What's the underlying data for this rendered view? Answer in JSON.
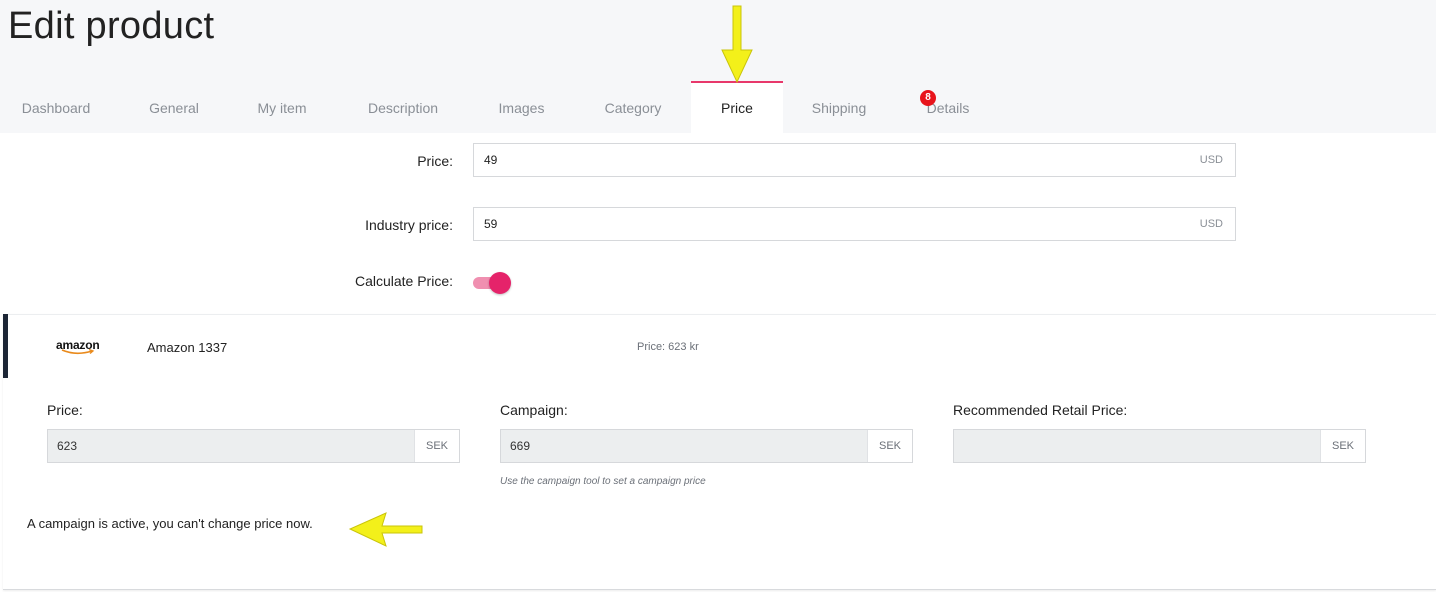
{
  "page": {
    "title": "Edit product"
  },
  "tabs": [
    {
      "label": "Dashboard",
      "active": false
    },
    {
      "label": "General",
      "active": false
    },
    {
      "label": "My item",
      "active": false
    },
    {
      "label": "Description",
      "active": false
    },
    {
      "label": "Images",
      "active": false
    },
    {
      "label": "Category",
      "active": false
    },
    {
      "label": "Price",
      "active": true
    },
    {
      "label": "Shipping",
      "active": false
    },
    {
      "label": "Details",
      "active": false,
      "badge": "8"
    }
  ],
  "price_form": {
    "price_label": "Price:",
    "price_value": "49",
    "price_unit": "USD",
    "industry_label": "Industry price:",
    "industry_value": "59",
    "industry_unit": "USD",
    "calculate_label": "Calculate Price:",
    "calculate_on": true
  },
  "channel": {
    "logo_text": "amazon",
    "name": "Amazon 1337",
    "price_text": "Price: 623 kr",
    "fields": {
      "price_label": "Price:",
      "price_value": "623",
      "price_unit": "SEK",
      "campaign_label": "Campaign:",
      "campaign_value": "669",
      "campaign_unit": "SEK",
      "campaign_hint": "Use the campaign tool to set a campaign price",
      "rrp_label": "Recommended Retail Price:",
      "rrp_value": "",
      "rrp_unit": "SEK"
    },
    "notice": "A campaign is active, you can't change price now."
  },
  "colors": {
    "accent": "#e5236a",
    "toggle_track": "#f08fb0",
    "badge": "#e8141c",
    "annotation_arrow": "#f3f01a",
    "card_stripe": "#1d2636"
  },
  "icons": {
    "annotation_arrows": "yellow-arrow-icon"
  }
}
